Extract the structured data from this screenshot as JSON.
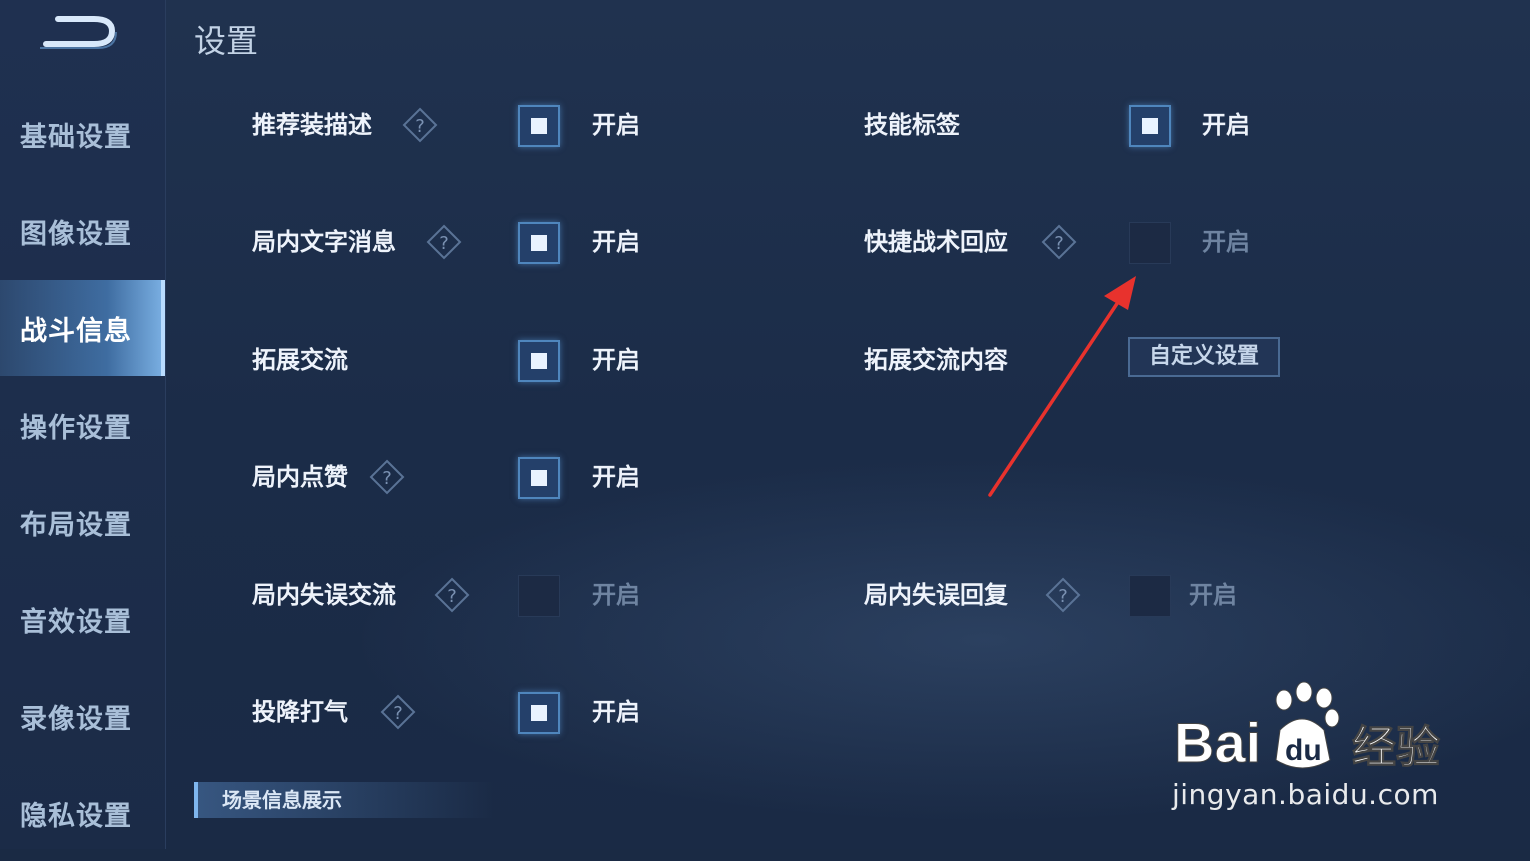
{
  "title": "设置",
  "sidebar": {
    "items": [
      {
        "label": "基础设置"
      },
      {
        "label": "图像设置"
      },
      {
        "label": "战斗信息",
        "active": true
      },
      {
        "label": "操作设置"
      },
      {
        "label": "布局设置"
      },
      {
        "label": "音效设置"
      },
      {
        "label": "录像设置"
      },
      {
        "label": "隐私设置"
      }
    ]
  },
  "settings": {
    "left": [
      {
        "label": "推荐装描述",
        "help": true,
        "checked": true,
        "state": "开启"
      },
      {
        "label": "局内文字消息",
        "help": true,
        "checked": true,
        "state": "开启"
      },
      {
        "label": "拓展交流",
        "help": false,
        "checked": true,
        "state": "开启"
      },
      {
        "label": "局内点赞",
        "help": true,
        "checked": true,
        "state": "开启"
      },
      {
        "label": "局内失误交流",
        "help": true,
        "checked": false,
        "state": "开启"
      },
      {
        "label": "投降打气",
        "help": true,
        "checked": true,
        "state": "开启"
      }
    ],
    "right": [
      {
        "label": "技能标签",
        "help": false,
        "checked": true,
        "state": "开启"
      },
      {
        "label": "快捷战术回应",
        "help": true,
        "checked": false,
        "state": "开启"
      },
      {
        "label": "拓展交流内容",
        "help": false,
        "button": "自定义设置"
      },
      {
        "label": "局内失误回复",
        "help": true,
        "checked": false,
        "state": "开启"
      }
    ]
  },
  "section_header": "场景信息展示",
  "watermark": {
    "brand": "Baidu经验",
    "url": "jingyan.baidu.com"
  },
  "colors": {
    "checkbox_on": "#24406a",
    "annotation_arrow": "#e8322d"
  }
}
